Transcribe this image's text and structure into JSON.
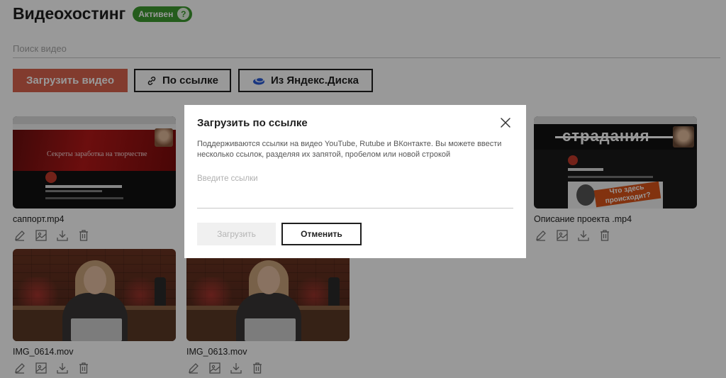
{
  "header": {
    "title": "Видеохостинг",
    "status_badge": "Активен",
    "help_icon": "?"
  },
  "search": {
    "placeholder": "Поиск видео",
    "value": ""
  },
  "toolbar": {
    "upload_label": "Загрузить видео",
    "by_link_label": "По ссылке",
    "yandex_disk_label": "Из Яндекс.Диска",
    "link_icon": "link-icon",
    "disk_icon": "yandex-disk-icon"
  },
  "videos": [
    {
      "name": "саппорт.mp4",
      "thumb": "website-red",
      "thumb_text": "Секреты заработка на творчестве"
    },
    {
      "name": "Описание проекта .mp4",
      "thumb": "creator-page",
      "banner_text": "страдания",
      "poster_text": "Что здесь происходит?"
    },
    {
      "name": "IMG_0614.mov",
      "thumb": "girl-laptop"
    },
    {
      "name": "IMG_0613.mov",
      "thumb": "girl-laptop"
    }
  ],
  "video_actions": [
    "edit-icon",
    "image-icon",
    "download-icon",
    "trash-icon"
  ],
  "modal": {
    "title": "Загрузить по ссылке",
    "description": "Поддерживаются ссылки на видео YouTube, Rutube и ВКонтакте. Вы можете ввести несколько ссылок, разделяя их запятой, пробелом или новой строкой",
    "input_placeholder": "Введите ссылки",
    "input_value": "",
    "upload_label": "Загрузить",
    "cancel_label": "Отменить"
  },
  "colors": {
    "accent": "#d9634e",
    "badge_green": "#3d9a2f",
    "text": "#1f1f1f"
  }
}
